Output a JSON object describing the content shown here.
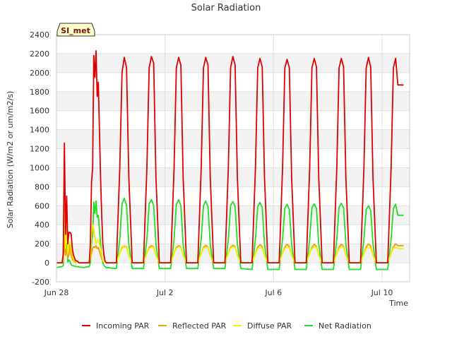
{
  "chart_data": {
    "type": "line",
    "title": "Solar Radiation",
    "xlabel": "Time",
    "ylabel": "Solar Radiation (W/m2 or um/m2/s)",
    "badge": "SI_met",
    "ylim": [
      -200,
      2400
    ],
    "yticks": [
      -200,
      0,
      200,
      400,
      600,
      800,
      1000,
      1200,
      1400,
      1600,
      1800,
      2000,
      2200,
      2400
    ],
    "xlim": [
      "2023-06-28",
      "2023-07-11T00:24"
    ],
    "xticks": [
      {
        "date": "2023-06-28",
        "label": "Jun 28"
      },
      {
        "date": "2023-07-02",
        "label": "Jul 2"
      },
      {
        "date": "2023-07-06",
        "label": "Jul 6"
      },
      {
        "date": "2023-07-10",
        "label": "Jul 10"
      }
    ],
    "grid": "horizontal bands",
    "legend_position": "bottom",
    "sample_times": [
      "2023-06-28T00:24",
      "2023-06-28T05:00",
      "2023-06-28T06:00",
      "2023-06-28T07:00",
      "2023-06-28T08:00",
      "2023-06-28T09:00",
      "2023-06-28T10:00",
      "2023-06-28T11:00",
      "2023-06-28T12:00",
      "2023-06-28T13:00",
      "2023-06-28T14:00",
      "2023-06-28T15:00",
      "2023-06-28T16:00",
      "2023-06-28T17:00",
      "2023-06-28T18:00",
      "2023-06-28T19:00",
      "2023-06-28T20:00",
      "2023-06-29T00:00",
      "2023-06-29T05:00",
      "2023-06-29T06:00",
      "2023-06-29T07:00",
      "2023-06-29T08:00",
      "2023-06-29T09:00",
      "2023-06-29T10:00",
      "2023-06-29T11:00",
      "2023-06-29T12:00",
      "2023-06-29T13:00",
      "2023-06-29T14:00",
      "2023-06-29T15:00",
      "2023-06-29T16:00",
      "2023-06-29T17:00",
      "2023-06-29T18:00",
      "2023-06-29T19:00",
      "2023-06-29T20:00",
      "2023-06-30T05:00",
      "2023-06-30T08:00",
      "2023-06-30T10:00",
      "2023-06-30T12:00",
      "2023-06-30T14:00",
      "2023-06-30T16:00",
      "2023-06-30T19:00",
      "2023-07-01T05:00",
      "2023-07-01T08:00",
      "2023-07-01T10:00",
      "2023-07-01T12:00",
      "2023-07-01T14:00",
      "2023-07-01T16:00",
      "2023-07-01T19:00",
      "2023-07-02T05:00",
      "2023-07-02T08:00",
      "2023-07-02T10:00",
      "2023-07-02T12:00",
      "2023-07-02T14:00",
      "2023-07-02T16:00",
      "2023-07-02T19:00",
      "2023-07-03T05:00",
      "2023-07-03T08:00",
      "2023-07-03T10:00",
      "2023-07-03T12:00",
      "2023-07-03T14:00",
      "2023-07-03T16:00",
      "2023-07-03T19:00",
      "2023-07-04T05:00",
      "2023-07-04T08:00",
      "2023-07-04T10:00",
      "2023-07-04T12:00",
      "2023-07-04T14:00",
      "2023-07-04T16:00",
      "2023-07-04T19:00",
      "2023-07-05T05:00",
      "2023-07-05T08:00",
      "2023-07-05T10:00",
      "2023-07-05T12:00",
      "2023-07-05T14:00",
      "2023-07-05T16:00",
      "2023-07-05T19:00",
      "2023-07-06T05:00",
      "2023-07-06T08:00",
      "2023-07-06T10:00",
      "2023-07-06T12:00",
      "2023-07-06T14:00",
      "2023-07-06T16:00",
      "2023-07-06T19:00",
      "2023-07-07T05:00",
      "2023-07-07T08:00",
      "2023-07-07T10:00",
      "2023-07-07T12:00",
      "2023-07-07T14:00",
      "2023-07-07T16:00",
      "2023-07-07T19:00",
      "2023-07-08T05:00",
      "2023-07-08T08:00",
      "2023-07-08T10:00",
      "2023-07-08T12:00",
      "2023-07-08T14:00",
      "2023-07-08T16:00",
      "2023-07-08T19:00",
      "2023-07-09T05:00",
      "2023-07-09T08:00",
      "2023-07-09T10:00",
      "2023-07-09T12:00",
      "2023-07-09T14:00",
      "2023-07-09T16:00",
      "2023-07-09T19:00",
      "2023-07-10T05:00",
      "2023-07-10T08:00",
      "2023-07-10T10:00",
      "2023-07-10T12:00",
      "2023-07-10T14:00",
      "2023-07-10T16:00",
      "2023-07-10T19:00",
      "2023-07-11T05:00",
      "2023-07-11T08:00",
      "2023-07-11T10:00",
      "2023-07-11T12:00",
      "2023-07-11T14:00",
      "2023-07-11T16:00",
      "2023-07-11T19:00"
    ],
    "series": [
      {
        "name": "Incoming PAR",
        "color": "#dd0000",
        "values": [
          0,
          0,
          100,
          1260,
          300,
          700,
          200,
          320,
          320,
          300,
          150,
          80,
          50,
          20,
          20,
          10,
          0,
          0,
          0,
          200,
          850,
          1000,
          2180,
          1950,
          2230,
          1750,
          1900,
          1400,
          900,
          500,
          200,
          80,
          20,
          0,
          0,
          1000,
          2000,
          2160,
          2050,
          900,
          0,
          0,
          1000,
          2050,
          2170,
          2100,
          900,
          0,
          0,
          1000,
          2050,
          2160,
          2080,
          900,
          0,
          0,
          1000,
          2050,
          2160,
          2080,
          900,
          0,
          0,
          1000,
          2050,
          2170,
          2080,
          900,
          0,
          0,
          1000,
          2050,
          2150,
          2060,
          900,
          0,
          0,
          1000,
          2050,
          2140,
          2050,
          900,
          0,
          0,
          1000,
          2050,
          2150,
          2060,
          900,
          0,
          0,
          1000,
          2050,
          2150,
          2060,
          900,
          0,
          0,
          1000,
          2050,
          2160,
          2060,
          900,
          0,
          0,
          1000,
          2050,
          2150,
          1870,
          1870,
          1870
        ]
      },
      {
        "name": "Reflected PAR",
        "color": "#f0a000",
        "values": [
          0,
          0,
          20,
          250,
          80,
          150,
          50,
          80,
          200,
          80,
          40,
          20,
          10,
          5,
          5,
          0,
          0,
          0,
          0,
          40,
          100,
          150,
          170,
          160,
          180,
          150,
          160,
          120,
          80,
          40,
          20,
          10,
          5,
          0,
          0,
          100,
          160,
          175,
          165,
          80,
          0,
          0,
          100,
          160,
          180,
          165,
          80,
          0,
          0,
          100,
          160,
          180,
          165,
          80,
          0,
          0,
          100,
          160,
          185,
          165,
          80,
          0,
          0,
          100,
          160,
          185,
          170,
          80,
          0,
          0,
          100,
          165,
          190,
          170,
          80,
          0,
          0,
          100,
          165,
          195,
          170,
          80,
          0,
          0,
          100,
          165,
          195,
          170,
          80,
          0,
          0,
          100,
          165,
          195,
          170,
          80,
          0,
          0,
          100,
          165,
          200,
          175,
          80,
          0,
          0,
          100,
          165,
          200,
          180,
          180,
          180
        ]
      },
      {
        "name": "Diffuse PAR",
        "color": "#f5f000",
        "values": [
          0,
          0,
          50,
          580,
          150,
          480,
          100,
          200,
          220,
          150,
          80,
          40,
          20,
          10,
          5,
          0,
          0,
          0,
          0,
          80,
          300,
          400,
          350,
          250,
          200,
          220,
          250,
          200,
          150,
          80,
          30,
          10,
          5,
          0,
          0,
          100,
          150,
          170,
          160,
          80,
          0,
          0,
          100,
          150,
          165,
          160,
          80,
          0,
          0,
          100,
          150,
          170,
          160,
          80,
          0,
          0,
          100,
          150,
          165,
          160,
          80,
          0,
          0,
          100,
          150,
          170,
          160,
          80,
          0,
          0,
          100,
          150,
          160,
          155,
          80,
          0,
          0,
          100,
          150,
          165,
          160,
          80,
          0,
          0,
          100,
          150,
          170,
          160,
          80,
          0,
          0,
          100,
          150,
          170,
          160,
          80,
          0,
          0,
          100,
          150,
          160,
          155,
          80,
          0,
          0,
          100,
          150,
          160,
          150,
          150,
          150
        ]
      },
      {
        "name": "Net Radiation",
        "color": "#22dd22",
        "values": [
          -50,
          -40,
          -30,
          320,
          100,
          200,
          10,
          30,
          10,
          -20,
          -30,
          -30,
          -35,
          -40,
          -40,
          -40,
          -45,
          -50,
          -40,
          0,
          200,
          300,
          640,
          520,
          650,
          480,
          500,
          350,
          200,
          80,
          0,
          -30,
          -40,
          -50,
          -60,
          250,
          620,
          680,
          600,
          200,
          -60,
          -60,
          250,
          620,
          665,
          600,
          200,
          -60,
          -60,
          250,
          610,
          665,
          600,
          200,
          -60,
          -60,
          250,
          600,
          650,
          590,
          200,
          -60,
          -60,
          250,
          600,
          645,
          590,
          200,
          -60,
          -70,
          250,
          590,
          635,
          580,
          200,
          -70,
          -70,
          250,
          570,
          615,
          560,
          200,
          -70,
          -70,
          250,
          580,
          620,
          570,
          200,
          -70,
          -70,
          250,
          585,
          625,
          575,
          200,
          -70,
          -70,
          250,
          560,
          600,
          550,
          200,
          -70,
          -70,
          250,
          570,
          615,
          500,
          500,
          500
        ]
      }
    ]
  }
}
